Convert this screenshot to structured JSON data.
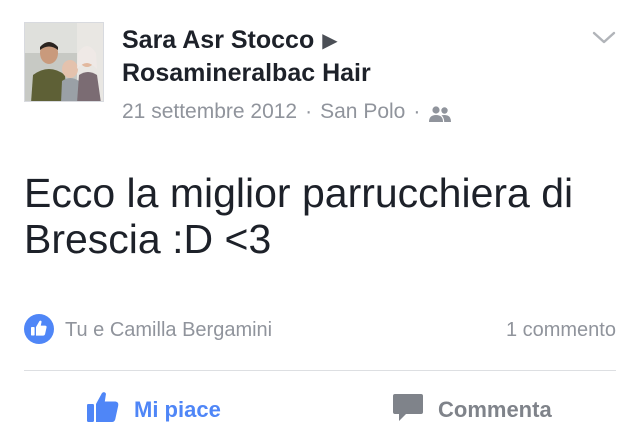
{
  "post": {
    "author": "Sara Asr Stocco",
    "arrow": "▶",
    "target": "Rosamineralbac Hair",
    "date": "21 settembre 2012",
    "separator": "·",
    "location": "San Polo",
    "audience_icon": "friends-icon",
    "menu_icon": "chevron-down-icon",
    "message": "Ecco la miglior parrucchiera di Brescia :D <3"
  },
  "reactions": {
    "icon": "like-badge-icon",
    "reactors": "Tu e Camilla Bergamini",
    "comment_count": "1 commento"
  },
  "actions": {
    "like_label": "Mi piace",
    "comment_label": "Commenta"
  },
  "colors": {
    "accent_blue": "#4f86f7",
    "text_dark": "#1d2129",
    "text_muted": "#90949c",
    "divider": "#dddfe2"
  }
}
